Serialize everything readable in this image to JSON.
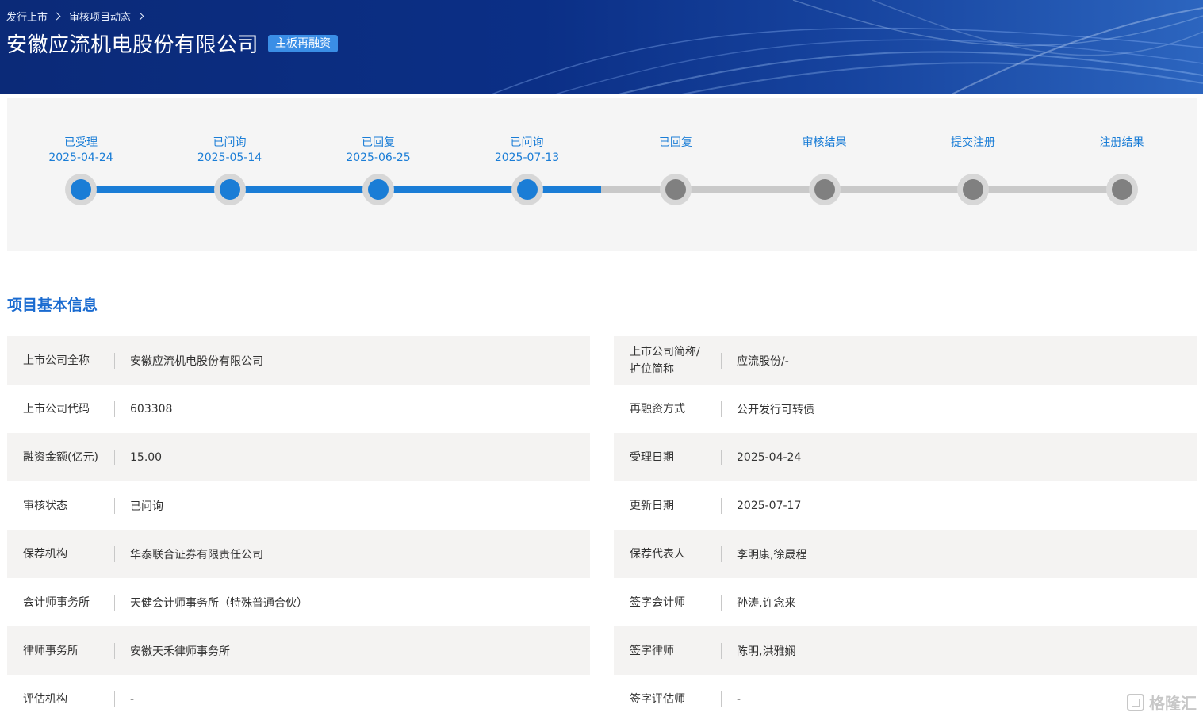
{
  "header": {
    "breadcrumb": [
      {
        "label": "发行上市"
      },
      {
        "label": "审核项目动态"
      }
    ],
    "title": "安徽应流机电股份有限公司",
    "tag": "主板再融资"
  },
  "progress": {
    "completed_count": 4,
    "steps": [
      {
        "label": "已受理",
        "date": "2025-04-24",
        "done": true
      },
      {
        "label": "已问询",
        "date": "2025-05-14",
        "done": true
      },
      {
        "label": "已回复",
        "date": "2025-06-25",
        "done": true
      },
      {
        "label": "已问询",
        "date": "2025-07-13",
        "done": true
      },
      {
        "label": "已回复",
        "date": "",
        "done": false
      },
      {
        "label": "审核结果",
        "date": "",
        "done": false
      },
      {
        "label": "提交注册",
        "date": "",
        "done": false
      },
      {
        "label": "注册结果",
        "date": "",
        "done": false
      }
    ]
  },
  "section": {
    "title": "项目基本信息"
  },
  "info": {
    "left": [
      {
        "label": "上市公司全称",
        "value": "安徽应流机电股份有限公司"
      },
      {
        "label": "上市公司代码",
        "value": "603308"
      },
      {
        "label": "融资金额(亿元)",
        "value": "15.00"
      },
      {
        "label": "审核状态",
        "value": "已问询"
      },
      {
        "label": "保荐机构",
        "value": "华泰联合证券有限责任公司"
      },
      {
        "label": "会计师事务所",
        "value": "天健会计师事务所（特殊普通合伙）"
      },
      {
        "label": "律师事务所",
        "value": "安徽天禾律师事务所"
      },
      {
        "label": "评估机构",
        "value": "-"
      }
    ],
    "right": [
      {
        "label": "上市公司简称/扩位简称",
        "value": "应流股份/-"
      },
      {
        "label": "再融资方式",
        "value": "公开发行可转债"
      },
      {
        "label": "受理日期",
        "value": "2025-04-24"
      },
      {
        "label": "更新日期",
        "value": "2025-07-17"
      },
      {
        "label": "保荐代表人",
        "value": "李明康,徐晟程"
      },
      {
        "label": "签字会计师",
        "value": "孙涛,许念来"
      },
      {
        "label": "签字律师",
        "value": "陈明,洪雅娴"
      },
      {
        "label": "签字评估师",
        "value": "-"
      }
    ]
  },
  "watermark": {
    "text": "格隆汇",
    "icon": "gelonghui-logo-icon"
  },
  "colors": {
    "accent": "#1a7dd6",
    "banner": "#0b2f86",
    "pending": "#808080",
    "row_shade": "#f4f3f2"
  }
}
